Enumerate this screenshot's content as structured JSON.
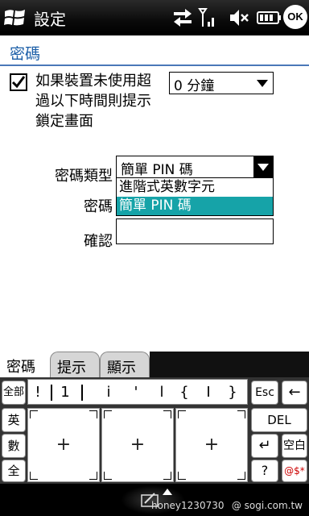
{
  "titlebar": {
    "title": "設定",
    "ok_label": "OK",
    "icons": [
      "windows-start-icon",
      "data-transfer-icon",
      "signal-icon",
      "volume-mute-icon",
      "battery-icon"
    ]
  },
  "section": {
    "title": "密碼"
  },
  "lock": {
    "checked": true,
    "label": "如果裝置未使用超過以下時間則提示鎖定畫面",
    "timeout_value": "0 分鐘"
  },
  "form": {
    "password_type_label": "密碼類型",
    "password_label": "密碼",
    "confirm_label": "確認",
    "password_type_value": "簡單 PIN 碼",
    "password_type_options": [
      "進階式英數字元",
      "簡單 PIN 碼"
    ],
    "password_type_selected_index": 1
  },
  "tabs": [
    {
      "label": "密碼",
      "active": true
    },
    {
      "label": "提示",
      "active": false
    },
    {
      "label": "顯示",
      "active": false
    }
  ],
  "keyboard": {
    "left_keys": [
      "全部",
      "英",
      "數",
      "全"
    ],
    "symbols": [
      "!",
      "1",
      "i",
      "'",
      "l",
      "{",
      "I",
      "}"
    ],
    "pad_symbol": "+",
    "right_keys": {
      "esc": "Esc",
      "back": "←",
      "del": "DEL",
      "enter": "↵",
      "space": "空白",
      "question": "?",
      "special": "@$*"
    }
  },
  "watermark": {
    "user": "honey1230730",
    "site": "@ sogi.com.tw"
  }
}
